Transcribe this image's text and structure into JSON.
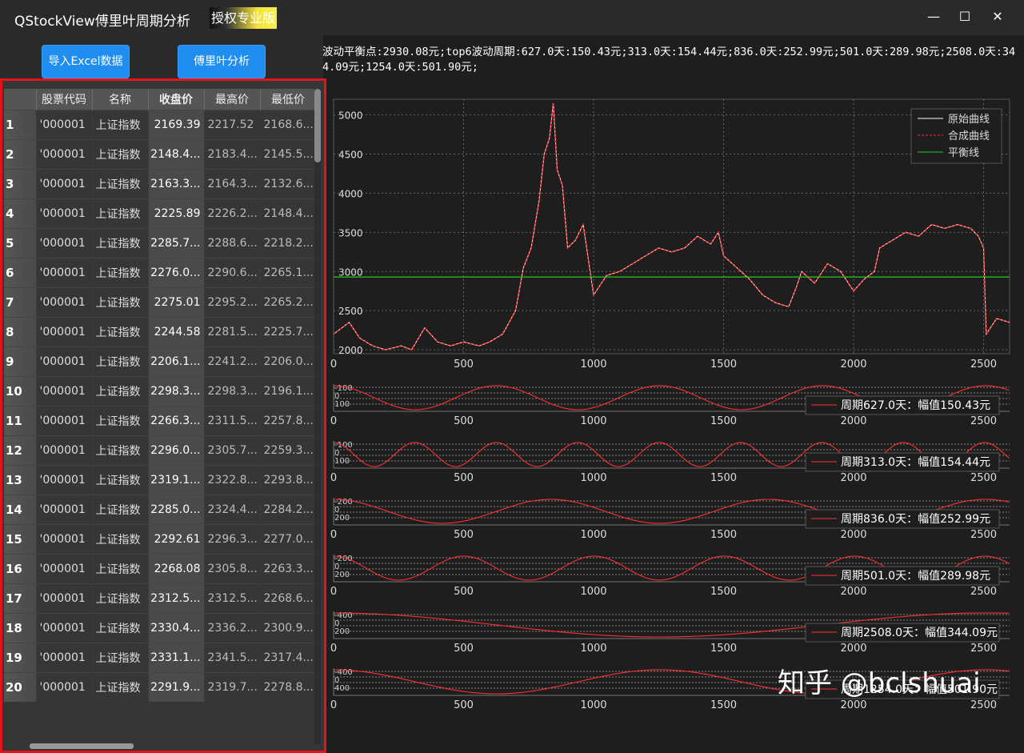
{
  "window": {
    "title": "QStockView傅里叶周期分析",
    "badge": "授权专业版",
    "minimize": "—",
    "maximize": "☐",
    "close": "✕"
  },
  "toolbar": {
    "import_label": "导入Excel数据",
    "analyze_label": "傅里叶分析"
  },
  "table": {
    "headers": [
      "股票代码",
      "名称",
      "收盘价",
      "最高价",
      "最低价"
    ],
    "rows": [
      [
        "1",
        "'000001",
        "上证指数",
        "2169.39",
        "2217.52",
        "2168.6..."
      ],
      [
        "2",
        "'000001",
        "上证指数",
        "2148.4...",
        "2183.4...",
        "2145.5..."
      ],
      [
        "3",
        "'000001",
        "上证指数",
        "2163.3...",
        "2164.3...",
        "2132.6..."
      ],
      [
        "4",
        "'000001",
        "上证指数",
        "2225.89",
        "2226.2...",
        "2148.4..."
      ],
      [
        "5",
        "'000001",
        "上证指数",
        "2285.7...",
        "2288.6...",
        "2218.2..."
      ],
      [
        "6",
        "'000001",
        "上证指数",
        "2276.0...",
        "2290.6...",
        "2265.1..."
      ],
      [
        "7",
        "'000001",
        "上证指数",
        "2275.01",
        "2295.2...",
        "2265.2..."
      ],
      [
        "8",
        "'000001",
        "上证指数",
        "2244.58",
        "2281.5...",
        "2225.7..."
      ],
      [
        "9",
        "'000001",
        "上证指数",
        "2206.1...",
        "2241.2...",
        "2206.0..."
      ],
      [
        "10",
        "'000001",
        "上证指数",
        "2298.3...",
        "2298.3...",
        "2196.1..."
      ],
      [
        "11",
        "'000001",
        "上证指数",
        "2266.3...",
        "2311.5...",
        "2257.8..."
      ],
      [
        "12",
        "'000001",
        "上证指数",
        "2296.0...",
        "2305.7...",
        "2259.3..."
      ],
      [
        "13",
        "'000001",
        "上证指数",
        "2319.1...",
        "2322.8...",
        "2293.8..."
      ],
      [
        "14",
        "'000001",
        "上证指数",
        "2285.0...",
        "2324.4...",
        "2284.2..."
      ],
      [
        "15",
        "'000001",
        "上证指数",
        "2292.61",
        "2296.3...",
        "2277.0..."
      ],
      [
        "16",
        "'000001",
        "上证指数",
        "2268.08",
        "2305.8...",
        "2263.3..."
      ],
      [
        "17",
        "'000001",
        "上证指数",
        "2312.5...",
        "2312.5...",
        "2268.6..."
      ],
      [
        "18",
        "'000001",
        "上证指数",
        "2330.4...",
        "2336.2...",
        "2300.9..."
      ],
      [
        "19",
        "'000001",
        "上证指数",
        "2331.1...",
        "2341.5...",
        "2317.4..."
      ],
      [
        "20",
        "'000001",
        "上证指数",
        "2291.9...",
        "2319.7...",
        "2278.8..."
      ]
    ]
  },
  "info_text": "波动平衡点:2930.08元;top6波动周期:627.0天:150.43元;313.0天:154.44元;836.0天:252.99元;501.0天:289.98元;2508.0天:344.09元;1254.0天:501.90元;",
  "colors": {
    "accent": "#1f8ef0",
    "highlight": "#e0141a",
    "original": "#ffffff",
    "synthetic": "#ff3030",
    "balance": "#22cc22"
  },
  "chart_data": [
    {
      "type": "line",
      "x_ticks": [
        0,
        500,
        1000,
        1500,
        2000,
        2500
      ],
      "y_ticks": [
        2000,
        2500,
        3000,
        3500,
        4000,
        4500,
        5000
      ],
      "xlim": [
        0,
        2600
      ],
      "ylim": [
        1950,
        5200
      ],
      "legend": {
        "position": "top-right",
        "entries": [
          "原始曲线",
          "合成曲线",
          "平衡线"
        ]
      },
      "balance": 2930.08,
      "series": [
        {
          "name": "原始曲线",
          "x": [
            0,
            60,
            100,
            150,
            200,
            260,
            300,
            350,
            400,
            450,
            500,
            560,
            600,
            650,
            700,
            730,
            760,
            790,
            810,
            830,
            845,
            860,
            880,
            900,
            930,
            960,
            1000,
            1050,
            1100,
            1150,
            1200,
            1250,
            1300,
            1350,
            1400,
            1450,
            1480,
            1500,
            1550,
            1600,
            1650,
            1700,
            1750,
            1780,
            1800,
            1850,
            1900,
            1950,
            2000,
            2040,
            2080,
            2100,
            2150,
            2200,
            2250,
            2300,
            2350,
            2400,
            2450,
            2480,
            2500,
            2510,
            2550,
            2600
          ],
          "y": [
            2200,
            2350,
            2150,
            2050,
            2000,
            2050,
            2000,
            2280,
            2100,
            2050,
            2100,
            2050,
            2100,
            2200,
            2500,
            3050,
            3300,
            3900,
            4500,
            4700,
            5150,
            4300,
            4100,
            3300,
            3400,
            3600,
            2700,
            2950,
            3000,
            3100,
            3200,
            3300,
            3250,
            3300,
            3450,
            3350,
            3500,
            3200,
            3050,
            2900,
            2700,
            2600,
            2550,
            2800,
            3000,
            2850,
            3100,
            3000,
            2750,
            2900,
            3000,
            3300,
            3400,
            3500,
            3450,
            3600,
            3550,
            3600,
            3550,
            3450,
            3300,
            2200,
            2400,
            2350
          ]
        }
      ]
    },
    {
      "type": "line",
      "label": "周期627.0天：幅值150.43元",
      "period": 627.0,
      "amplitude": 150.43,
      "y_ticks": [
        -100,
        0,
        100
      ],
      "x_ticks": [
        0,
        500,
        1000,
        1500,
        2000,
        2500
      ]
    },
    {
      "type": "line",
      "label": "周期313.0天：幅值154.44元",
      "period": 313.0,
      "amplitude": 154.44,
      "y_ticks": [
        -100,
        0,
        100
      ],
      "x_ticks": [
        0,
        500,
        1000,
        1500,
        2000,
        2500
      ]
    },
    {
      "type": "line",
      "label": "周期836.0天：幅值252.99元",
      "period": 836.0,
      "amplitude": 252.99,
      "y_ticks": [
        -200,
        0,
        200
      ],
      "x_ticks": [
        0,
        500,
        1000,
        1500,
        2000,
        2500
      ]
    },
    {
      "type": "line",
      "label": "周期501.0天：幅值289.98元",
      "period": 501.0,
      "amplitude": 289.98,
      "y_ticks": [
        -200,
        0,
        200
      ],
      "x_ticks": [
        0,
        500,
        1000,
        1500,
        2000,
        2500
      ]
    },
    {
      "type": "line",
      "label": "周期2508.0天：幅值344.09元",
      "period": 2508.0,
      "amplitude": 344.09,
      "y_ticks": [
        -400,
        0,
        200
      ],
      "x_ticks": [
        0,
        500,
        1000,
        1500,
        2000,
        2500
      ]
    },
    {
      "type": "line",
      "label": "周期1254.0天：幅值501.90元",
      "period": 1254.0,
      "amplitude": 501.9,
      "y_ticks": [
        -400,
        0,
        400
      ],
      "x_ticks": [
        0,
        500,
        1000,
        1500,
        2000,
        2500
      ]
    }
  ],
  "watermark": "知乎 @bclshuai"
}
